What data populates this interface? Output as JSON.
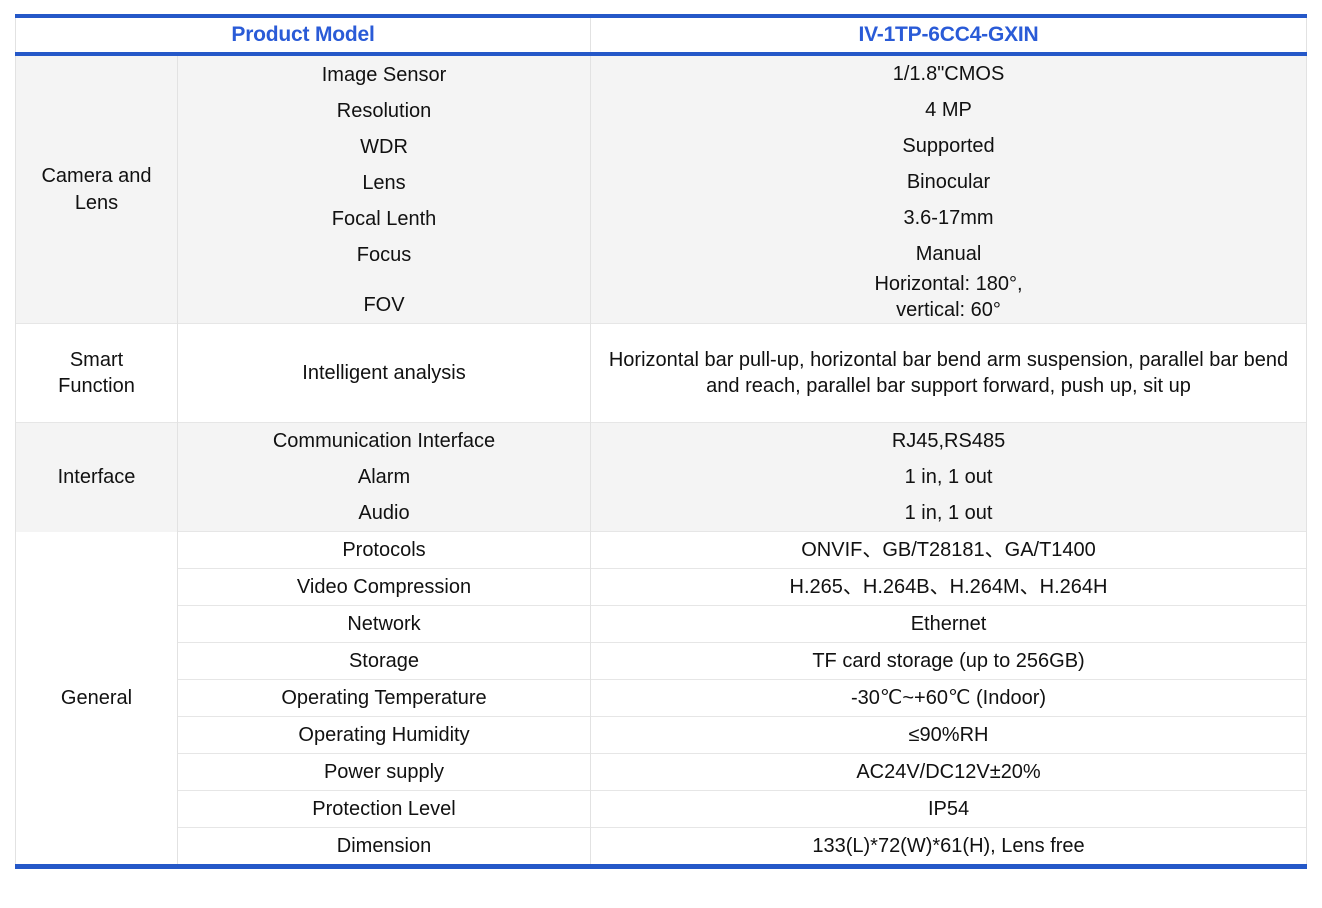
{
  "theme": {
    "accent_blue": "#2558c8",
    "header_text_blue": "#2a5bd7",
    "band_gray": "#f4f4f4",
    "grid_gray": "#e2e2e2"
  },
  "table": {
    "header": {
      "column_category": "Product Model",
      "column_value": "IV-1TP-6CC4-GXIN"
    },
    "sections": [
      {
        "category": "Camera and\nLens",
        "category_line1": "Camera and",
        "category_line2": "Lens",
        "band": "gray",
        "rows": [
          {
            "label": "Image Sensor",
            "value": "1/1.8\"CMOS"
          },
          {
            "label": "Resolution",
            "value": "4 MP"
          },
          {
            "label": "WDR",
            "value": "Supported"
          },
          {
            "label": "Lens",
            "value": "Binocular"
          },
          {
            "label": "Focal Lenth",
            "value": "3.6-17mm"
          },
          {
            "label": "Focus",
            "value": "Manual"
          },
          {
            "label": "FOV",
            "value": "Horizontal: 180°,\nvertical: 60°",
            "value_line1": "Horizontal: 180°,",
            "value_line2": "vertical: 60°"
          }
        ]
      },
      {
        "category": "Smart\nFunction",
        "category_line1": "Smart",
        "category_line2": "Function",
        "band": "white",
        "rows": [
          {
            "label": "Intelligent analysis",
            "value": "Horizontal bar pull-up, horizontal bar bend arm suspension, parallel bar bend and reach, parallel bar support forward, push up, sit up"
          }
        ]
      },
      {
        "category": "Interface",
        "band": "gray",
        "rows": [
          {
            "label": "Communication Interface",
            "value": "RJ45,RS485"
          },
          {
            "label": "Alarm",
            "value": "1 in, 1 out"
          },
          {
            "label": "Audio",
            "value": "1 in, 1 out"
          }
        ]
      },
      {
        "category": "General",
        "band": "white",
        "rows": [
          {
            "label": "Protocols",
            "value": "ONVIF、GB/T28181、GA/T1400"
          },
          {
            "label": "Video Compression",
            "value": "H.265、H.264B、H.264M、H.264H"
          },
          {
            "label": "Network",
            "value": "Ethernet"
          },
          {
            "label": "Storage",
            "value": "TF card storage (up to 256GB)"
          },
          {
            "label": "Operating Temperature",
            "value": "-30℃~+60℃ (Indoor)"
          },
          {
            "label": "Operating Humidity",
            "value": "≤90%RH"
          },
          {
            "label": "Power supply",
            "value": "AC24V/DC12V±20%"
          },
          {
            "label": "Protection Level",
            "value": "IP54"
          },
          {
            "label": "Dimension",
            "value": "133(L)*72(W)*61(H), Lens free"
          }
        ]
      }
    ]
  }
}
